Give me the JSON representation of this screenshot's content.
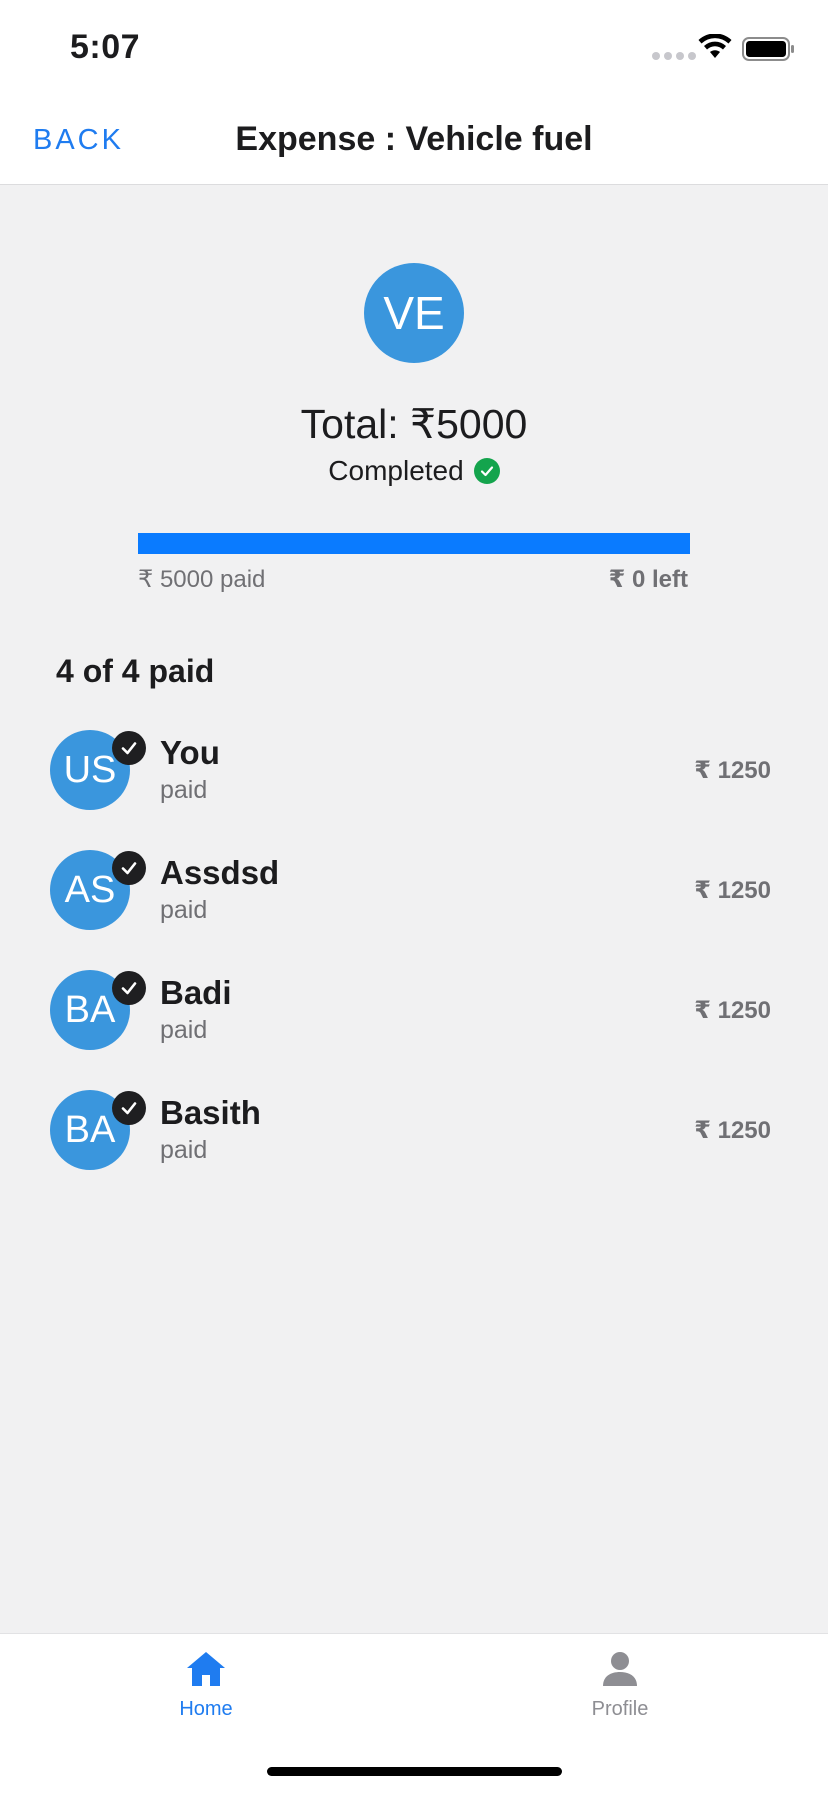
{
  "status_bar": {
    "time": "5:07"
  },
  "nav": {
    "back_label": "BACK",
    "title": "Expense : Vehicle fuel"
  },
  "expense": {
    "initials": "VE",
    "total_text": "Total: ₹5000",
    "status": "Completed",
    "progress_fraction": 1.0,
    "paid_text": "₹ 5000 paid",
    "left_text": "₹ 0 left"
  },
  "members_heading": "4 of 4 paid",
  "members": [
    {
      "initials": "US",
      "name": "You",
      "status": "paid",
      "amount": "₹ 1250"
    },
    {
      "initials": "AS",
      "name": "Assdsd",
      "status": "paid",
      "amount": "₹ 1250"
    },
    {
      "initials": "BA",
      "name": "Badi",
      "status": "paid",
      "amount": "₹ 1250"
    },
    {
      "initials": "BA",
      "name": "Basith",
      "status": "paid",
      "amount": "₹ 1250"
    }
  ],
  "tabs": [
    {
      "label": "Home",
      "icon": "home-icon",
      "active": true
    },
    {
      "label": "Profile",
      "icon": "person-icon",
      "active": false
    }
  ],
  "colors": {
    "accent": "#1f7cf0",
    "avatar": "#3a96dd",
    "progress": "#0a7bff",
    "success": "#14a44d"
  }
}
